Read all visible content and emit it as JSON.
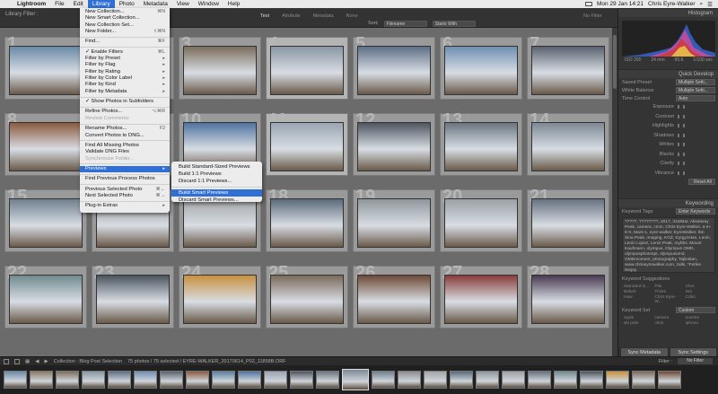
{
  "menubar": {
    "app": "Lightroom",
    "items": [
      "File",
      "Edit",
      "Library",
      "Photo",
      "Metadata",
      "View",
      "Window",
      "Help"
    ],
    "status_right": "Mon 29 Jan  14:21",
    "user": "Chris Eyre-Walker"
  },
  "grid_toolbar": {
    "library_filter": "Library Filter :",
    "tabs": [
      "Text",
      "Attribute",
      "Metadata",
      "None"
    ],
    "sort_label": "Sort:",
    "sort_value": "Filename",
    "sort_order": "Starts With",
    "no_filter": "No Filter"
  },
  "grid": {
    "cells": [
      {
        "num": "1"
      },
      {
        "num": "2"
      },
      {
        "num": "3"
      },
      {
        "num": "4"
      },
      {
        "num": "5"
      },
      {
        "num": "6"
      },
      {
        "num": "7"
      },
      {
        "num": "8"
      },
      {
        "num": "9"
      },
      {
        "num": "10"
      },
      {
        "num": "11"
      },
      {
        "num": "12"
      },
      {
        "num": "13"
      },
      {
        "num": "14"
      },
      {
        "num": "15"
      },
      {
        "num": "16"
      },
      {
        "num": "17"
      },
      {
        "num": "18"
      },
      {
        "num": "19"
      },
      {
        "num": "20"
      },
      {
        "num": "21"
      },
      {
        "num": "22"
      },
      {
        "num": "23"
      },
      {
        "num": "24"
      },
      {
        "num": "25"
      },
      {
        "num": "26"
      },
      {
        "num": "27"
      },
      {
        "num": "28"
      }
    ],
    "thumb_colors": [
      "#6a8aa8",
      "#8a7a66",
      "#7b6e5c",
      "#8a97a4",
      "#5d6f86",
      "#6f8fb3",
      "#5a6270",
      "#8b5a3e",
      "#5a7ea0",
      "#4f73a1",
      "#9aa6b3",
      "#4e5560",
      "#6a7580",
      "#7d8995",
      "#70808e",
      "#8c8f92",
      "#a2a6aa",
      "#5a6a7a",
      "#8f969d",
      "#9ba1a6",
      "#667080",
      "#708c90",
      "#4c555f",
      "#c9913f",
      "#7a6a5a",
      "#6e4a36",
      "#8a3c3a",
      "#4a3a50"
    ]
  },
  "library_menu": {
    "items": [
      {
        "label": "New Collection...",
        "sc": "⌘N",
        "dis": false
      },
      {
        "label": "New Smart Collection...",
        "sc": "",
        "dis": false
      },
      {
        "label": "New Collection Set...",
        "sc": "",
        "dis": false
      },
      {
        "label": "New Folder...",
        "sc": "⇧⌘N",
        "dis": false
      },
      {
        "sep": true
      },
      {
        "label": "Find...",
        "sc": "⌘F",
        "dis": false
      },
      {
        "sep": true
      },
      {
        "label": "✓ Enable Filters",
        "sc": "⌘L",
        "dis": false
      },
      {
        "label": "Filter by Preset",
        "sc": "▸",
        "dis": false
      },
      {
        "label": "Filter by Flag",
        "sc": "▸",
        "dis": false
      },
      {
        "label": "Filter by Rating",
        "sc": "▸",
        "dis": false
      },
      {
        "label": "Filter by Color Label",
        "sc": "▸",
        "dis": false
      },
      {
        "label": "Filter by Kind",
        "sc": "▸",
        "dis": false
      },
      {
        "label": "Filter by Metadata",
        "sc": "▸",
        "dis": false
      },
      {
        "sep": true
      },
      {
        "label": "✓ Show Photos in Subfolders",
        "sc": "",
        "dis": false
      },
      {
        "sep": true
      },
      {
        "label": "Refine Photos...",
        "sc": "⌥⌘R",
        "dis": false
      },
      {
        "label": "Review Comments",
        "sc": "",
        "dis": true
      },
      {
        "sep": true
      },
      {
        "label": "Rename Photos...",
        "sc": "F2",
        "dis": false
      },
      {
        "label": "Convert Photos to DNG...",
        "sc": "",
        "dis": false
      },
      {
        "sep": true
      },
      {
        "label": "Find All Missing Photos",
        "sc": "",
        "dis": false
      },
      {
        "label": "Validate DNG Files",
        "sc": "",
        "dis": false
      },
      {
        "label": "Synchronize Folder...",
        "sc": "",
        "dis": true
      },
      {
        "sep": true
      },
      {
        "label": "Previews",
        "sc": "▸",
        "dis": false,
        "hl": true
      },
      {
        "sep": true
      },
      {
        "label": "Find Previous Process Photos",
        "sc": "",
        "dis": false
      },
      {
        "sep": true
      },
      {
        "label": "Previous Selected Photo",
        "sc": "⌘←",
        "dis": false
      },
      {
        "label": "Next Selected Photo",
        "sc": "⌘→",
        "dis": false
      },
      {
        "sep": true
      },
      {
        "label": "Plug-in Extras",
        "sc": "▸",
        "dis": false
      }
    ]
  },
  "previews_submenu": {
    "group1": [
      "Build Standard-Sized Previews",
      "Build 1:1 Previews",
      "Discard 1:1 Previews..."
    ],
    "group2": [
      "Build Smart Previews",
      "Discard Smart Previews..."
    ]
  },
  "right_panel": {
    "histogram_title": "Histogram",
    "histo_meta": [
      "ISO 200",
      "24 mm",
      "f/5.6",
      "1/100 sec"
    ],
    "quick_develop_title": "Quick Develop",
    "saved_preset_label": "Saved Preset",
    "saved_preset_value": "Multiple Setti...",
    "white_balance_label": "White Balance",
    "white_balance_value": "Multiple Setti...",
    "tone_control_label": "Tone Control",
    "tone_control_value": "Auto",
    "tone_rows": [
      "Exposure",
      "Contrast",
      "Highlights",
      "Shadows",
      "Whites",
      "Blacks",
      "Clarity",
      "Vibrance"
    ],
    "reset_all": "Reset All",
    "keywording_title": "Keywording",
    "keyword_tags_label": "Keyword Tags",
    "keyword_tags_value": "Enter Keywords",
    "keywords_text": "?????, ????????, 2017, 31stMar, Aksaisray Peak, camera, cmm, Chris Eyre-Walker, a-m-6-X, Mars-1, eyre-walker, EyreWalker, Ibn Sina Peak, imaging, KGZ, Kyrgyzstan, Lenin, Lenin Lopez, Lenin Peak, mybbs, Mount Kaufmann, olympus, Olympus OMD, olympusphotoopt, olympusomd, OMDmoment, photography, Tajikistan, www.chriseyrewalker.com, zalki, *Ferkie Ninjey",
    "keyword_suggestions_title": "Keyword Suggestions",
    "keyword_suggestions": [
      "Standard D...",
      "Pila",
      "Clon",
      "Bokeh",
      "Tricks",
      "Nm",
      "Haw",
      "Chris Eyre-W...",
      "Cdsn"
    ],
    "keyword_set_label": "Keyword Set",
    "keyword_set_value": "Custom",
    "keyword_set_items": [
      "Sgob",
      "camera",
      "sunrise",
      "ski pole",
      "ctms",
      "iphono"
    ],
    "sync_metadata": "Sync Metadata",
    "sync_settings": "Sync Settings"
  },
  "filmstrip": {
    "collection_text": "Collection : Blog Post Selection",
    "count_text": "75 photos / 75 selected / EYRE-WALKER_20170614_P02_11858B.ORF",
    "filter_label": "Filter :",
    "filter_value": "No Filter"
  }
}
